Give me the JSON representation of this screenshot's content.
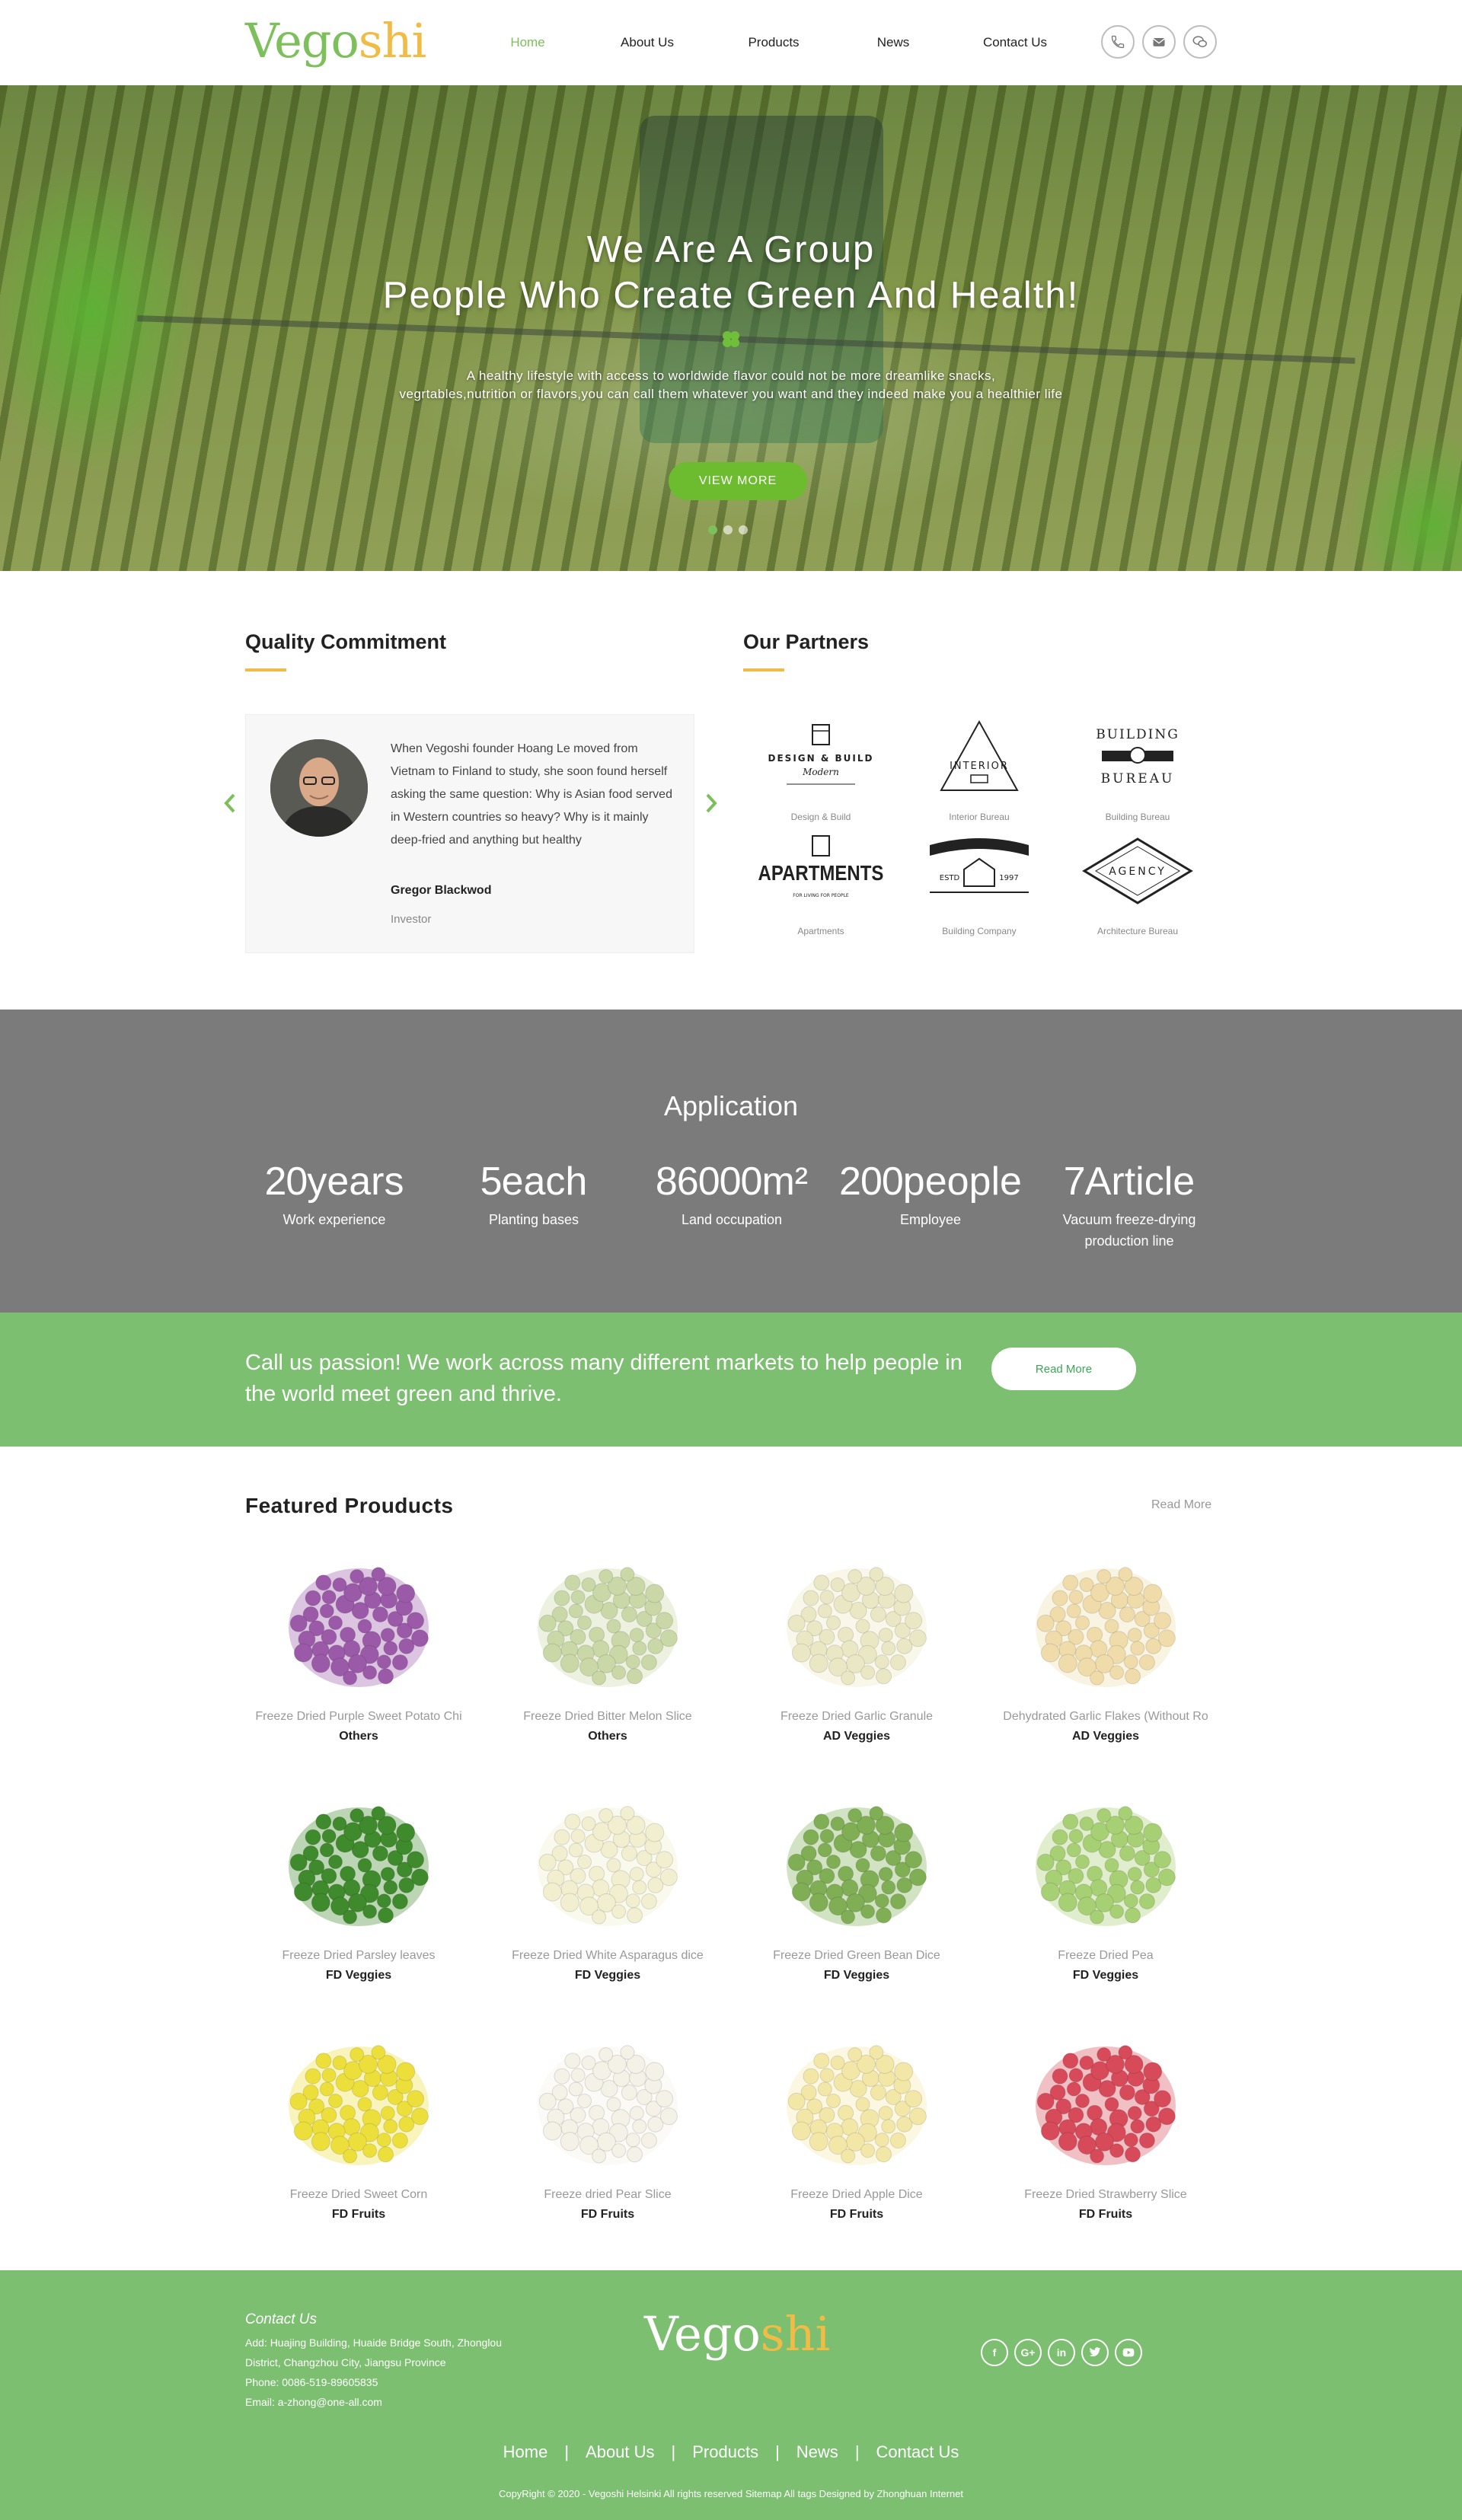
{
  "header": {
    "logo_part1": "Vego",
    "logo_part2": "shi",
    "nav": [
      "Home",
      "About Us",
      "Products",
      "News",
      "Contact Us"
    ],
    "active_nav": "Home",
    "icons": [
      "phone-icon",
      "mail-icon",
      "wechat-icon"
    ]
  },
  "hero": {
    "title_line1": "We Are A Group",
    "title_line2": "People Who Create Green And Health!",
    "subtitle_line1": "A healthy lifestyle with access to worldwide flavor could not be more dreamlike snacks,",
    "subtitle_line2": "vegrtables,nutrition or flavors,you can call them whatever you want and they indeed make you a healthier life",
    "button": "VIEW MORE",
    "slides": 3,
    "active_slide": 1
  },
  "quality": {
    "title": "Quality Commitment",
    "quote": "When Vegoshi founder Hoang Le moved from Vietnam to Finland to study, she soon found herself asking the same question: Why is Asian food served in Western countries so heavy? Why is it mainly deep-fried and anything but healthy",
    "name": "Gregor Blackwod",
    "role": "Investor"
  },
  "partners": {
    "title": "Our Partners",
    "items": [
      {
        "name": "Design & Build",
        "logo_text": "DESIGN & BUILD",
        "logo_sub": "Modern"
      },
      {
        "name": "Interior Bureau",
        "logo_text": "INTERIOR",
        "logo_sub": ""
      },
      {
        "name": "Building Bureau",
        "logo_text": "BUILDING",
        "logo_sub": "BUREAU"
      },
      {
        "name": "Apartments",
        "logo_text": "APARTMENTS",
        "logo_sub": "FOR LIVING FOR PEOPLE"
      },
      {
        "name": "Building Company",
        "logo_text": "ESTD",
        "logo_sub": "1997"
      },
      {
        "name": "Architecture Bureau",
        "logo_text": "AGENCY",
        "logo_sub": ""
      }
    ]
  },
  "application": {
    "title": "Application",
    "stats": [
      {
        "num": "20",
        "unit": "years",
        "label": "Work experience",
        "label2": ""
      },
      {
        "num": "5",
        "unit": "each",
        "label": "Planting bases",
        "label2": ""
      },
      {
        "num": "86000",
        "unit": "m²",
        "label": "Land occupation",
        "label2": ""
      },
      {
        "num": "200",
        "unit": "people",
        "label": "Employee",
        "label2": ""
      },
      {
        "num": "7",
        "unit": "Article",
        "label": "Vacuum freeze-drying",
        "label2": "production line"
      }
    ]
  },
  "banner": {
    "text": "Call us passion! We work across many different markets to help people in the world meet green and thrive.",
    "button": "Read More"
  },
  "products": {
    "title": "Featured Prouducts",
    "more": "Read More",
    "items": [
      {
        "name": "Freeze Dried Purple Sweet Potato Chi",
        "category": "Others",
        "color": "#9b5aa8"
      },
      {
        "name": "Freeze Dried Bitter Melon Slice",
        "category": "Others",
        "color": "#c9d8a6"
      },
      {
        "name": "Freeze Dried Garlic Granule",
        "category": "AD Veggies",
        "color": "#eae8c4"
      },
      {
        "name": "Dehydrated Garlic Flakes (Without Ro",
        "category": "AD Veggies",
        "color": "#efdcaa"
      },
      {
        "name": "Freeze Dried Parsley leaves",
        "category": "FD Veggies",
        "color": "#3f8a2c"
      },
      {
        "name": "Freeze Dried White Asparagus dice",
        "category": "FD Veggies",
        "color": "#f1efcf"
      },
      {
        "name": "Freeze Dried Green Bean Dice",
        "category": "FD Veggies",
        "color": "#7fae55"
      },
      {
        "name": "Freeze Dried Pea",
        "category": "FD Veggies",
        "color": "#a7cf74"
      },
      {
        "name": "Freeze Dried Sweet Corn",
        "category": "FD Fruits",
        "color": "#ecdf3c"
      },
      {
        "name": "Freeze dried Pear Slice",
        "category": "FD Fruits",
        "color": "#f4f1e6"
      },
      {
        "name": "Freeze Dried Apple Dice",
        "category": "FD Fruits",
        "color": "#f3e7a8"
      },
      {
        "name": "Freeze Dried Strawberry Slice",
        "category": "FD Fruits",
        "color": "#d74a5a"
      }
    ]
  },
  "footer": {
    "contact_title": "Contact Us",
    "lines": [
      "Add: Huajing Building, Huaide Bridge South, Zhonglou",
      "District, Changzhou City, Jiangsu Province",
      "Phone: 0086-519-89605835",
      "Email: a-zhong@one-all.com"
    ],
    "logo_part1": "Vego",
    "logo_part2": "shi",
    "social": [
      "f",
      "G+",
      "in",
      "t",
      "yt"
    ],
    "nav": [
      "Home",
      "About Us",
      "Products",
      "News",
      "Contact Us"
    ],
    "copyright": "CopyRight © 2020 - Vegoshi Helsinki  All rights reserved  Sitemap  All tags   Designed by Zhonghuan Internet"
  },
  "colors": {
    "brand_green": "#7cbf5b",
    "brand_yellow": "#f0bc45",
    "stats_bg": "#7b7b7b",
    "banner_bg": "#7cbf70"
  }
}
